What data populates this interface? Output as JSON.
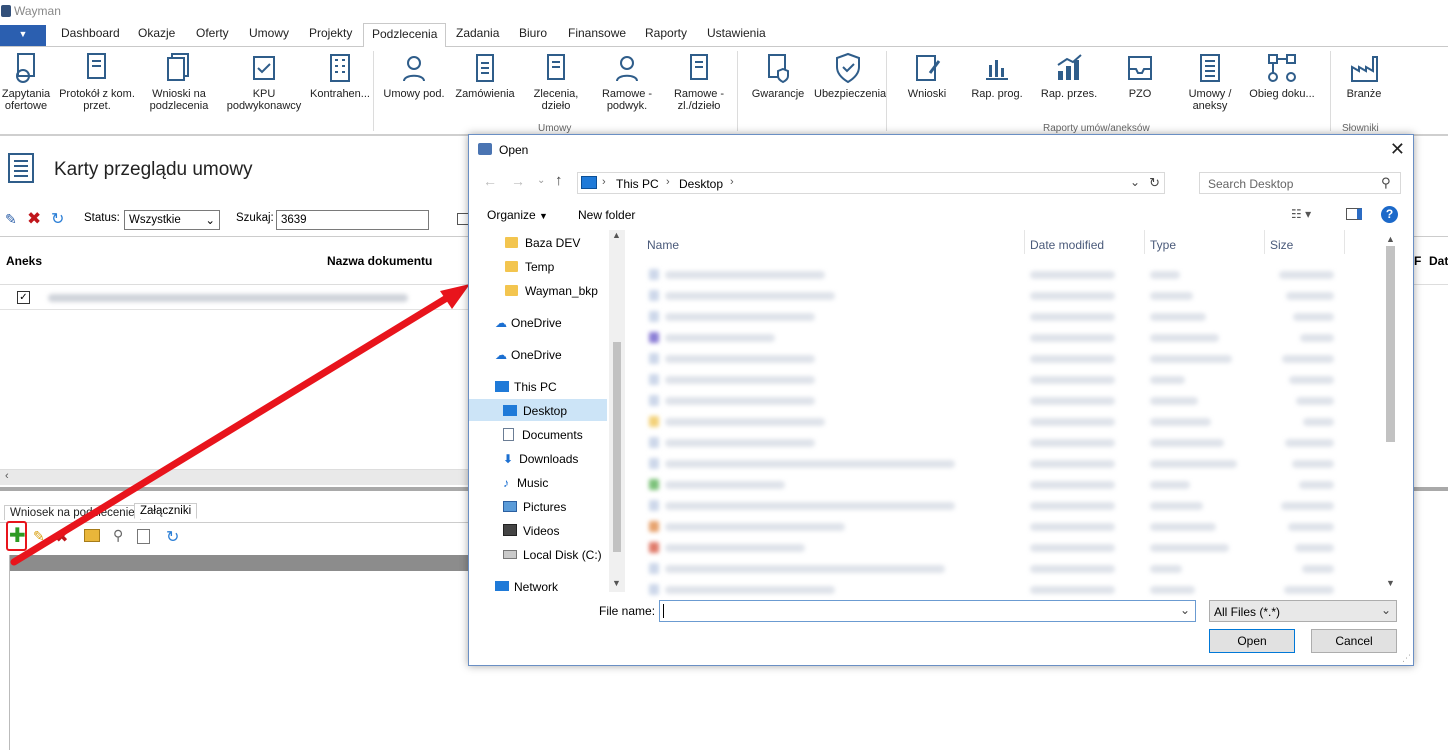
{
  "app": {
    "title": "Wayman"
  },
  "menu": {
    "tabs": [
      "Dashboard",
      "Okazje",
      "Oferty",
      "Umowy",
      "Projekty",
      "Podzlecenia",
      "Zadania",
      "Biuro",
      "Finansowe",
      "Raporty",
      "Ustawienia"
    ],
    "active": "Podzlecenia"
  },
  "ribbon": {
    "buttons": [
      "Zapytania ofertowe",
      "Protokół z kom. przet.",
      "Wnioski na podzlecenia",
      "KPU podwykonawcy",
      "Kontrahen...",
      "Umowy pod.",
      "Zamówienia",
      "Zlecenia, dzieło",
      "Ramowe - podwyk.",
      "Ramowe - zl./dzieło",
      "Gwarancje",
      "Ubezpieczenia",
      "Wnioski",
      "Rap. prog.",
      "Rap. przes.",
      "PZO",
      "Umowy / aneksy",
      "Obieg doku...",
      "Branże"
    ],
    "groups": [
      "Umowy",
      "Raporty umów/aneksów",
      "Słowniki"
    ]
  },
  "page": {
    "title": "Karty przeglądu umowy",
    "status_label": "Status:",
    "status_value": "Wszystkie",
    "search_label": "Szukaj:",
    "search_value": "3639"
  },
  "grid": {
    "columns": [
      "Aneks",
      "Nazwa dokumentu",
      "F",
      "Dat"
    ]
  },
  "lower_tabs": [
    "Wniosek na podzlecenie",
    "Załączniki"
  ],
  "dialog": {
    "title": "Open",
    "breadcrumb": [
      "This PC",
      "Desktop"
    ],
    "search_placeholder": "Search Desktop",
    "organize": "Organize",
    "new_folder": "New folder",
    "nav": [
      "Baza DEV",
      "Temp",
      "Wayman_bkp",
      "OneDrive",
      "OneDrive",
      "This PC",
      "Desktop",
      "Documents",
      "Downloads",
      "Music",
      "Pictures",
      "Videos",
      "Local Disk (C:)",
      "Network"
    ],
    "columns": [
      "Name",
      "Date modified",
      "Type",
      "Size"
    ],
    "filename_label": "File name:",
    "filename_value": "",
    "filter": "All Files (*.*)",
    "open": "Open",
    "cancel": "Cancel"
  },
  "colors": {
    "accent": "#2b5fb0",
    "arrow": "#e8141c",
    "selection": "#cce4f7"
  }
}
